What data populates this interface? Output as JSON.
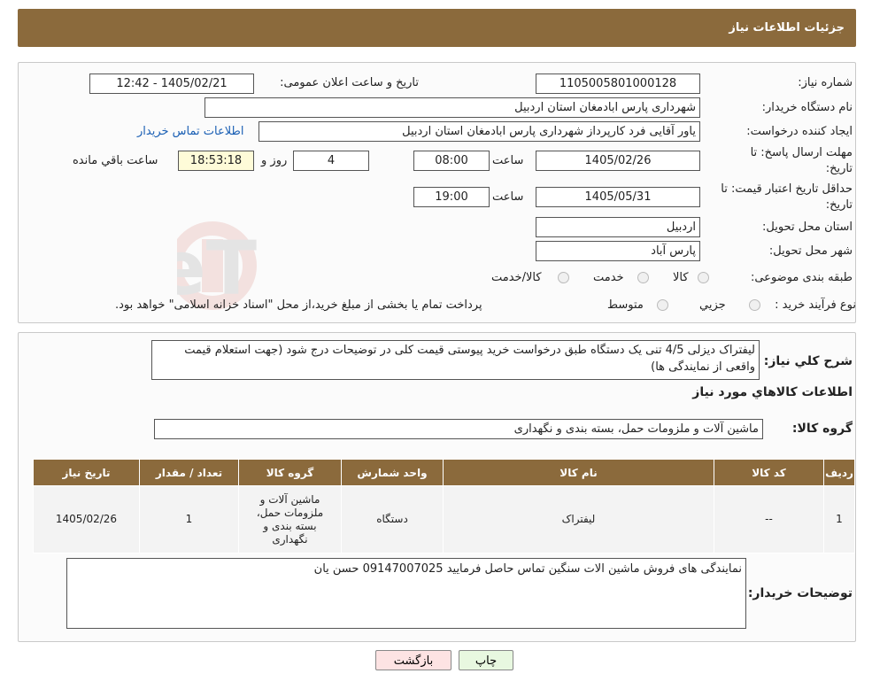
{
  "header": {
    "title": "جزئیات اطلاعات نیاز"
  },
  "form": {
    "need_number_label": "شماره نیاز:",
    "need_number": "1105005801000128",
    "announce_label": "تاریخ و ساعت اعلان عمومی:",
    "announce_value": "1405/02/21 - 12:42",
    "buyer_org_label": "نام دستگاه خریدار:",
    "buyer_org": "شهرداری پارس ابادمغان استان اردبیل",
    "creator_label": "ایجاد کننده درخواست:",
    "creator": "یاور آقایی فرد کارپرداز شهرداری پارس ابادمغان استان اردبیل",
    "contact_link": "اطلاعات تماس خریدار",
    "deadline_label_1": "مهلت ارسال پاسخ: تا",
    "deadline_label_2": "تاریخ:",
    "deadline_date": "1405/02/26",
    "time_word": "ساعت",
    "deadline_time": "08:00",
    "days_value": "4",
    "days_word": "روز و",
    "remaining_time": "18:53:18",
    "remaining_word": "ساعت باقي مانده",
    "validity_label_1": "حداقل تاریخ اعتبار قیمت: تا",
    "validity_label_2": "تاریخ:",
    "validity_date": "1405/05/31",
    "validity_time": "19:00",
    "province_label": "استان محل تحویل:",
    "province": "اردبیل",
    "city_label": "شهر محل تحویل:",
    "city": "پارس آباد",
    "category_label": "طبقه بندی موضوعی:",
    "category_options": [
      "کالا",
      "خدمت",
      "کالا/خدمت"
    ],
    "process_label": "نوع فرآیند خرید :",
    "process_options": [
      "جزیي",
      "متوسط"
    ],
    "process_note": "پرداخت تمام یا بخشی از مبلغ خرید،از محل \"اسناد خزانه اسلامی\" خواهد بود."
  },
  "description": {
    "label": "شرح کلي نیاز:",
    "text": "لیفتراک دیزلی 4/5 تنی یک دستگاه طبق درخواست خرید پیوستی قیمت کلی در توضیحات درج شود (جهت استعلام قیمت واقعی از نمایندگی ها)"
  },
  "items_section": {
    "title": "اطلاعات کالاهاي مورد نیاز",
    "group_label": "گروه کالا:",
    "group_value": "ماشین آلات و ملزومات حمل، بسته بندی و نگهداری"
  },
  "table": {
    "headers": [
      "ردیف",
      "کد کالا",
      "نام کالا",
      "واحد شمارش",
      "گروه کالا",
      "تعداد / مقدار",
      "تاریخ نیاز"
    ],
    "rows": [
      [
        "1",
        "--",
        "لیفتراک",
        "دستگاه",
        "ماشین آلات و ملزومات حمل، بسته بندی و نگهداری",
        "1",
        "1405/02/26"
      ]
    ]
  },
  "buyer_notes": {
    "label": "توضیحات خریدار:",
    "text": "نمایندگی های فروش ماشین الات سنگین تماس حاصل فرمایید 09147007025 حسن یان"
  },
  "buttons": {
    "print": "چاپ",
    "back": "بازگشت"
  },
  "watermark_text": "AriaTender.neT",
  "colors": {
    "header": "#8b6a3c",
    "link": "#1a5fb4",
    "yellow_box": "#fefbd8",
    "back_button": "#fde3e3",
    "print_button": "#e8f8e0"
  }
}
